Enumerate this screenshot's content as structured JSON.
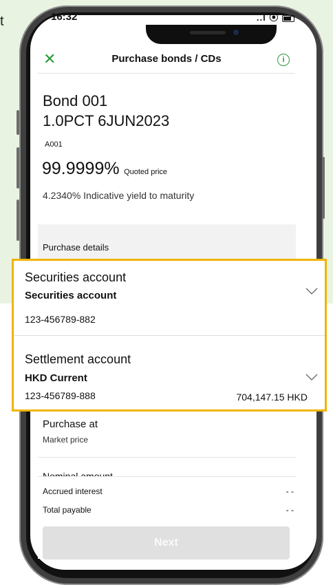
{
  "status_bar": {
    "time": "16:32",
    "signal": "..l",
    "wifi": "⦿"
  },
  "nav": {
    "close_symbol": "✕",
    "title": "Purchase bonds / CDs",
    "info_symbol": "i"
  },
  "bond": {
    "name": "Bond 001",
    "description": "1.0PCT 6JUN2023",
    "code": "A001",
    "quoted_price": "99.9999%",
    "quoted_price_label": "Quoted price",
    "yield_text": "4.2340% Indicative yield to maturity"
  },
  "purchase_details": {
    "section_label": "Purchase details",
    "securities_account": {
      "title": "Securities account",
      "selected": "Securities account",
      "number": "123-456789-882"
    },
    "settlement_account": {
      "title": "Settlement account",
      "selected": "HKD Current",
      "number": "123-456789-888",
      "balance": "704,147.15 HKD"
    },
    "purchase_at": {
      "label": "Purchase at",
      "value": "Market price"
    },
    "nominal_amount_label": "Nominal amount"
  },
  "summary": {
    "accrued_interest_label": "Accrued interest",
    "accrued_interest_value": "- -",
    "total_payable_label": "Total payable",
    "total_payable_value": "- -"
  },
  "next_button": "Next",
  "corner_text": "t",
  "colors": {
    "accent_green": "#2a9a3a",
    "highlight": "#f0b400",
    "background_green": "#e9f3e2",
    "button_disabled": "#e0e0e0"
  }
}
